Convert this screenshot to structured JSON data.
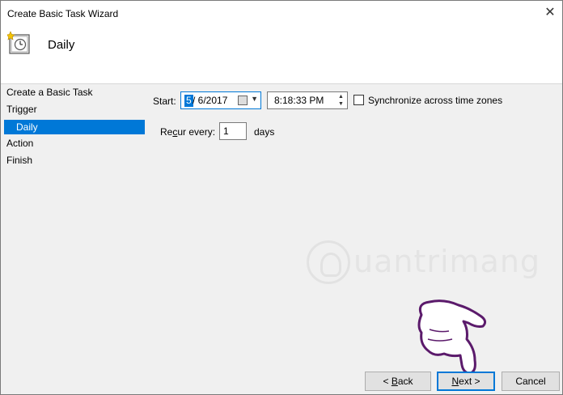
{
  "window": {
    "title": "Create Basic Task Wizard",
    "close_glyph": "✕"
  },
  "header": {
    "title": "Daily",
    "icon": "clock-task-icon"
  },
  "steps": [
    {
      "label": "Create a Basic Task"
    },
    {
      "label": "Trigger"
    },
    {
      "label": "Daily",
      "selected": true
    },
    {
      "label": "Action"
    },
    {
      "label": "Finish"
    }
  ],
  "form": {
    "start_label": "Start:",
    "date_first": "5",
    "date_rest": "/  6/2017",
    "time_value": "8:18:33 PM",
    "sync_label": "Synchronize across time zones",
    "sync_checked": false,
    "recur_prefix": "Re",
    "recur_accel": "c",
    "recur_suffix": "ur every:",
    "recur_value": "1",
    "recur_unit": "days"
  },
  "watermark": {
    "text": "uantrimang"
  },
  "buttons": {
    "back_prefix": "< ",
    "back_accel": "B",
    "back_suffix": "ack",
    "next_accel": "N",
    "next_suffix": "ext >",
    "cancel": "Cancel"
  },
  "colors": {
    "selection": "#0078d7",
    "dialog_bg": "#f0f0f0"
  }
}
